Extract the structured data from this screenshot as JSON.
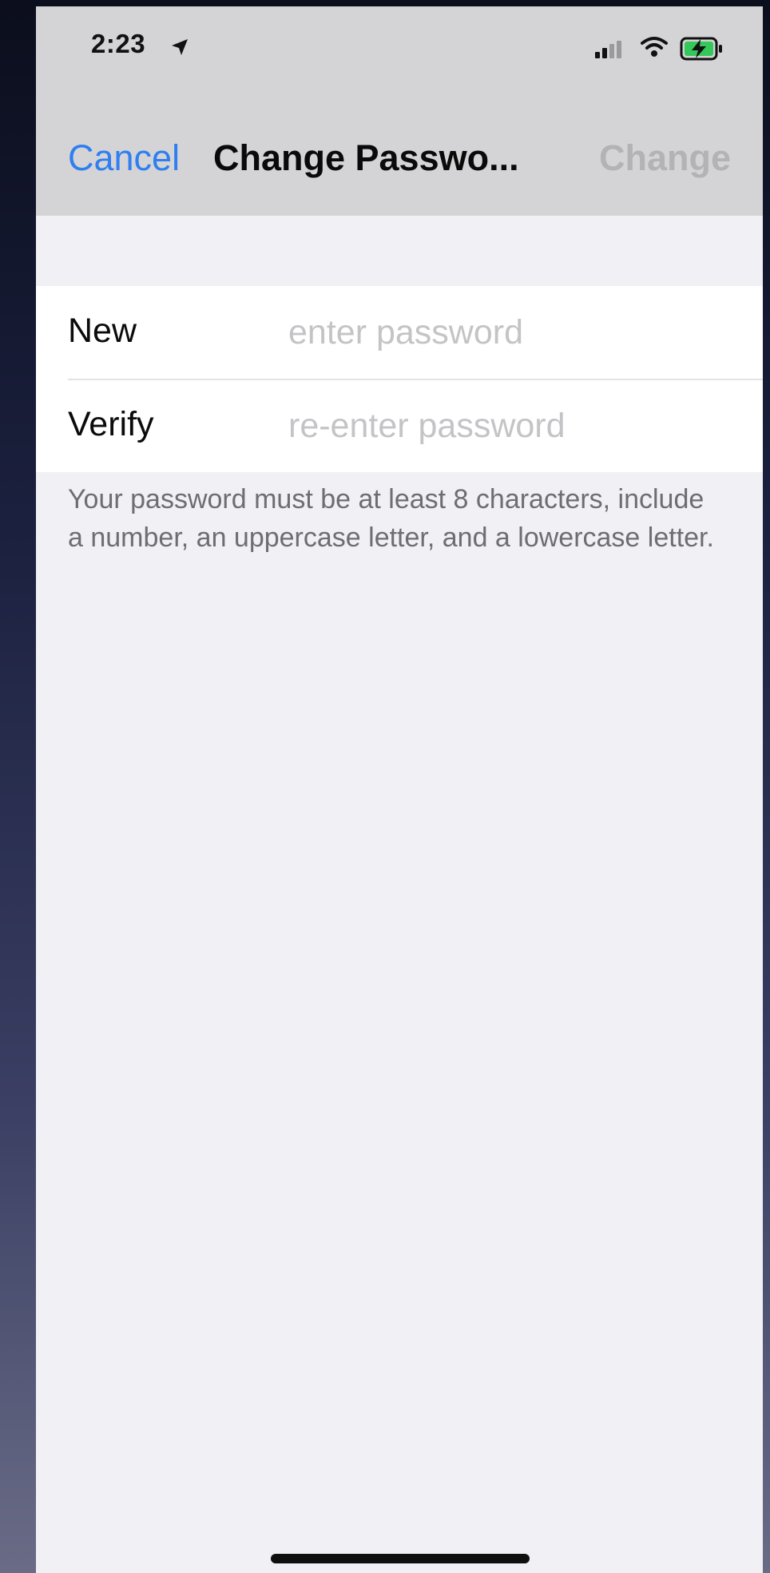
{
  "status_bar": {
    "time": "2:23"
  },
  "nav": {
    "cancel_label": "Cancel",
    "title": "Change Passwo...",
    "change_label": "Change"
  },
  "form": {
    "new_label": "New",
    "new_placeholder": "enter password",
    "verify_label": "Verify",
    "verify_placeholder": "re-enter password"
  },
  "helper_text": "Your password must be at least 8 characters, include a number, an uppercase letter, and a lowercase letter.",
  "colors": {
    "accent": "#2f7ff0",
    "disabled": "#b3b3b6",
    "battery_charging": "#34c759"
  },
  "icons": [
    "location-arrow-icon",
    "cellular-signal-icon",
    "wifi-icon",
    "battery-charging-icon"
  ]
}
